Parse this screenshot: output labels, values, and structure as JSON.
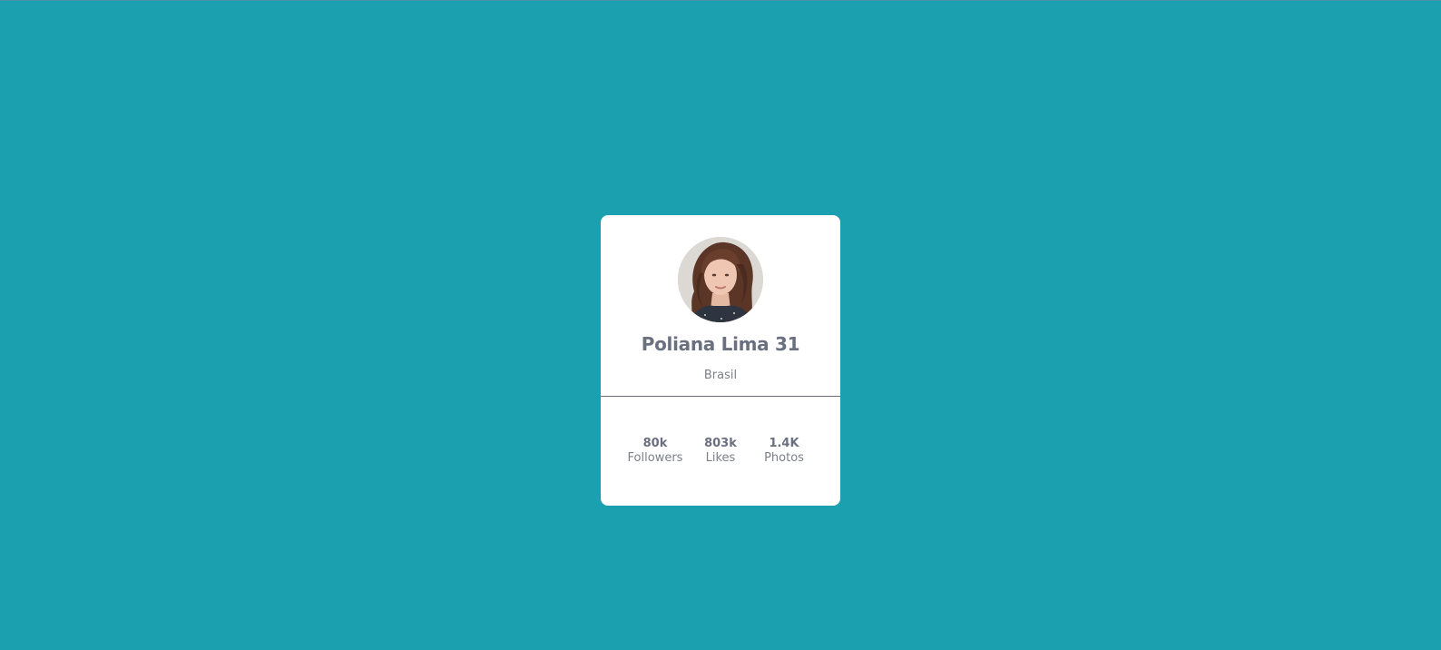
{
  "profile": {
    "name": "Poliana Lima 31",
    "location": "Brasil",
    "avatar_alt": "Profile photo"
  },
  "stats": [
    {
      "value": "80k",
      "label": "Followers"
    },
    {
      "value": "803k",
      "label": "Likes"
    },
    {
      "value": "1.4K",
      "label": "Photos"
    }
  ],
  "colors": {
    "background": "#1aa0ae",
    "card": "#ffffff",
    "text_primary": "#6b7080",
    "text_secondary": "#7c7f88"
  }
}
